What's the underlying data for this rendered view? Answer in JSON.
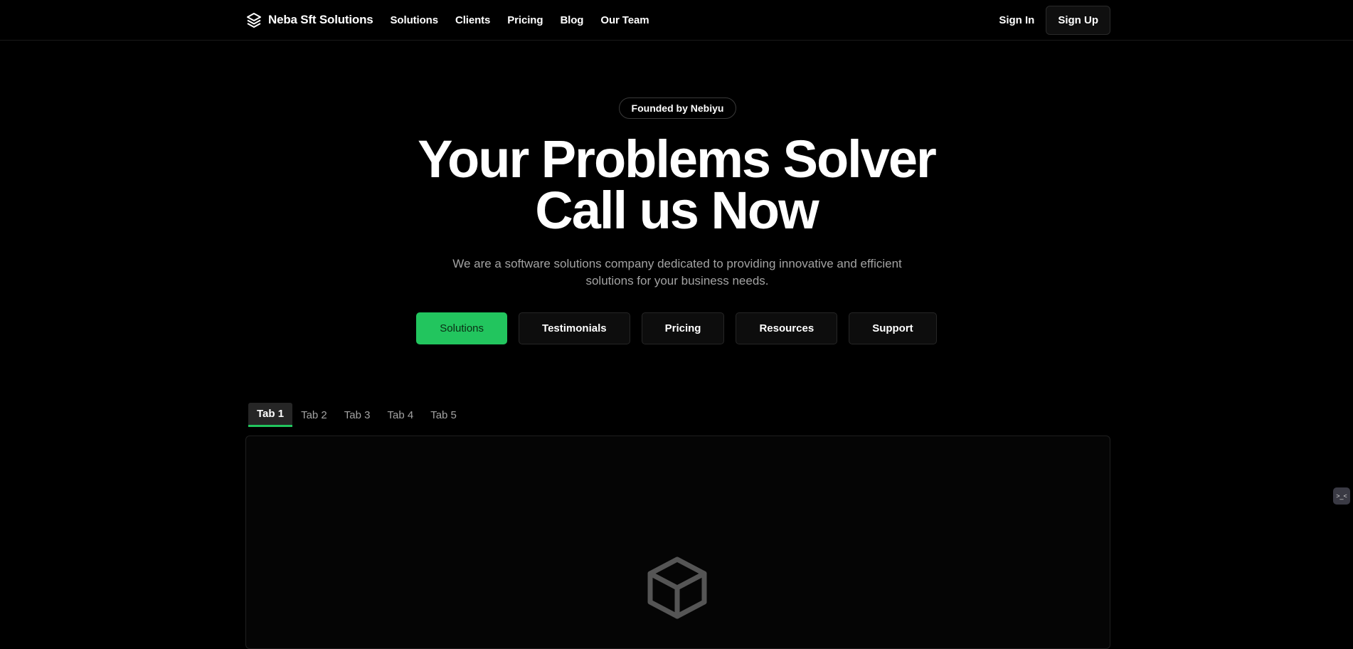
{
  "nav": {
    "brand": "Neba Sft Solutions",
    "links": [
      "Solutions",
      "Clients",
      "Pricing",
      "Blog",
      "Our Team"
    ],
    "sign_in": "Sign In",
    "sign_up": "Sign Up"
  },
  "hero": {
    "badge": "Founded by Nebiyu",
    "title_line1": "Your Problems Solver",
    "title_line2": "Call us Now",
    "subtitle": "We are a software solutions company dedicated to providing innovative and efficient solutions for your business needs.",
    "buttons": [
      "Solutions",
      "Testimonials",
      "Pricing",
      "Resources",
      "Support"
    ]
  },
  "tabs": [
    "Tab 1",
    "Tab 2",
    "Tab 3",
    "Tab 4",
    "Tab 5"
  ],
  "active_tab": "Tab 1",
  "widget": {
    "icon": "code-face-icon",
    "label": ">_<"
  },
  "colors": {
    "accent": "#22c55e",
    "background": "#000000",
    "muted_text": "#a3a3a3"
  },
  "icons": {
    "brand": "layers-icon",
    "panel": "box-icon"
  }
}
